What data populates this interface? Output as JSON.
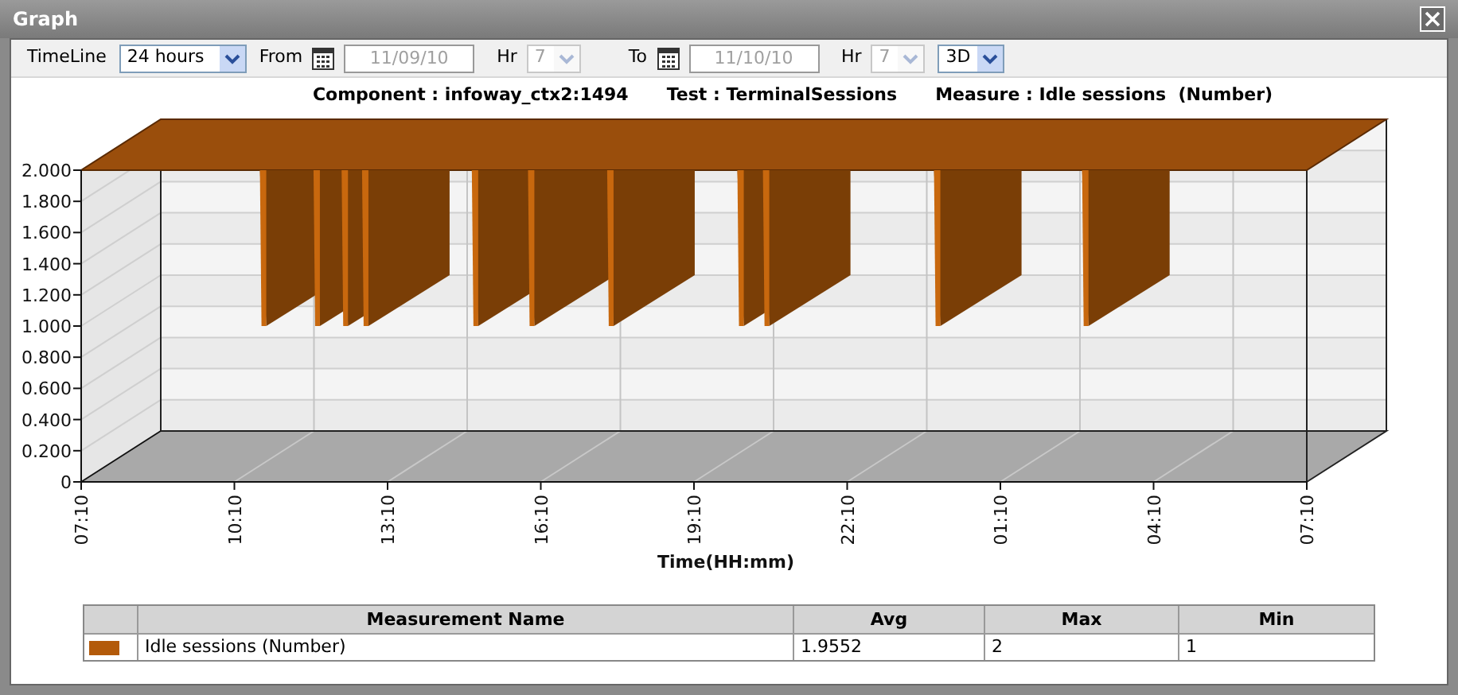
{
  "window": {
    "title": "Graph"
  },
  "toolbar": {
    "timeline_label": "TimeLine",
    "timeline": "24 hours",
    "view": "3D",
    "from": {
      "label": "From",
      "date": "11/09/10",
      "hr_label": "Hr",
      "hr": "7",
      "disabled": true
    },
    "to": {
      "label": "To",
      "date": "11/10/10",
      "hr_label": "Hr",
      "hr": "7",
      "disabled": true
    }
  },
  "chart_header": [
    "Component : infoway_ctx2:1494",
    "Test : TerminalSessions",
    "Measure : Idle sessions  (Number)"
  ],
  "chart": {
    "xlabel": "Time(HH:mm)",
    "y_tick_labels": [
      "2.000",
      "1.800",
      "1.600",
      "1.400",
      "1.200",
      "1.000",
      "0.800",
      "0.600",
      "0.400",
      "0.200",
      "0"
    ],
    "x_tick_labels": [
      "07:10",
      "10:10",
      "13:10",
      "16:10",
      "19:10",
      "22:10",
      "01:10",
      "04:10",
      "07:10"
    ]
  },
  "legend_table": {
    "columns": [
      "Measurement Name",
      "Avg",
      "Max",
      "Min"
    ],
    "rows": [
      {
        "color": "#b35a0a",
        "name": "Idle sessions (Number)",
        "avg": "1.9552",
        "max": "2",
        "min": "1"
      }
    ]
  }
}
